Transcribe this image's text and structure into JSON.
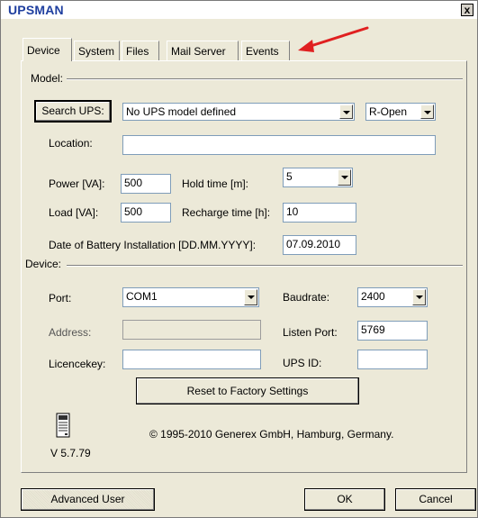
{
  "window": {
    "title": "UPSMAN",
    "close_label": "x"
  },
  "tabs": [
    {
      "label": "Device",
      "active": true
    },
    {
      "label": "System"
    },
    {
      "label": "Files"
    },
    {
      "label": "Mail Server"
    },
    {
      "label": "Events"
    }
  ],
  "sections": {
    "model": "Model:",
    "device": "Device:"
  },
  "model": {
    "search_button": "Search UPS:",
    "model_value": "No UPS model defined",
    "open_mode": "R-Open",
    "location_label": "Location:",
    "location_value": "",
    "power_label": "Power [VA]:",
    "power_value": "500",
    "holdtime_label": "Hold time [m]:",
    "holdtime_value": "5",
    "load_label": "Load [VA]:",
    "load_value": "500",
    "recharge_label": "Recharge time [h]:",
    "recharge_value": "10",
    "battery_label": "Date of Battery Installation [DD.MM.YYYY]:",
    "battery_value": "07.09.2010"
  },
  "device": {
    "port_label": "Port:",
    "port_value": "COM1",
    "baudrate_label": "Baudrate:",
    "baudrate_value": "2400",
    "address_label": "Address:",
    "address_value": "",
    "listen_label": "Listen Port:",
    "listen_value": "5769",
    "licence_label": "Licencekey:",
    "licence_value": "",
    "upsid_label": "UPS ID:",
    "upsid_value": "",
    "reset_button": "Reset to Factory Settings"
  },
  "about": {
    "copyright": "© 1995-2010 Generex GmbH, Hamburg, Germany.",
    "version": "V 5.7.79"
  },
  "footer": {
    "advanced_button": "Advanced User",
    "ok_button": "OK",
    "cancel_button": "Cancel"
  },
  "annotation": {
    "arrow_color": "#e02020"
  }
}
